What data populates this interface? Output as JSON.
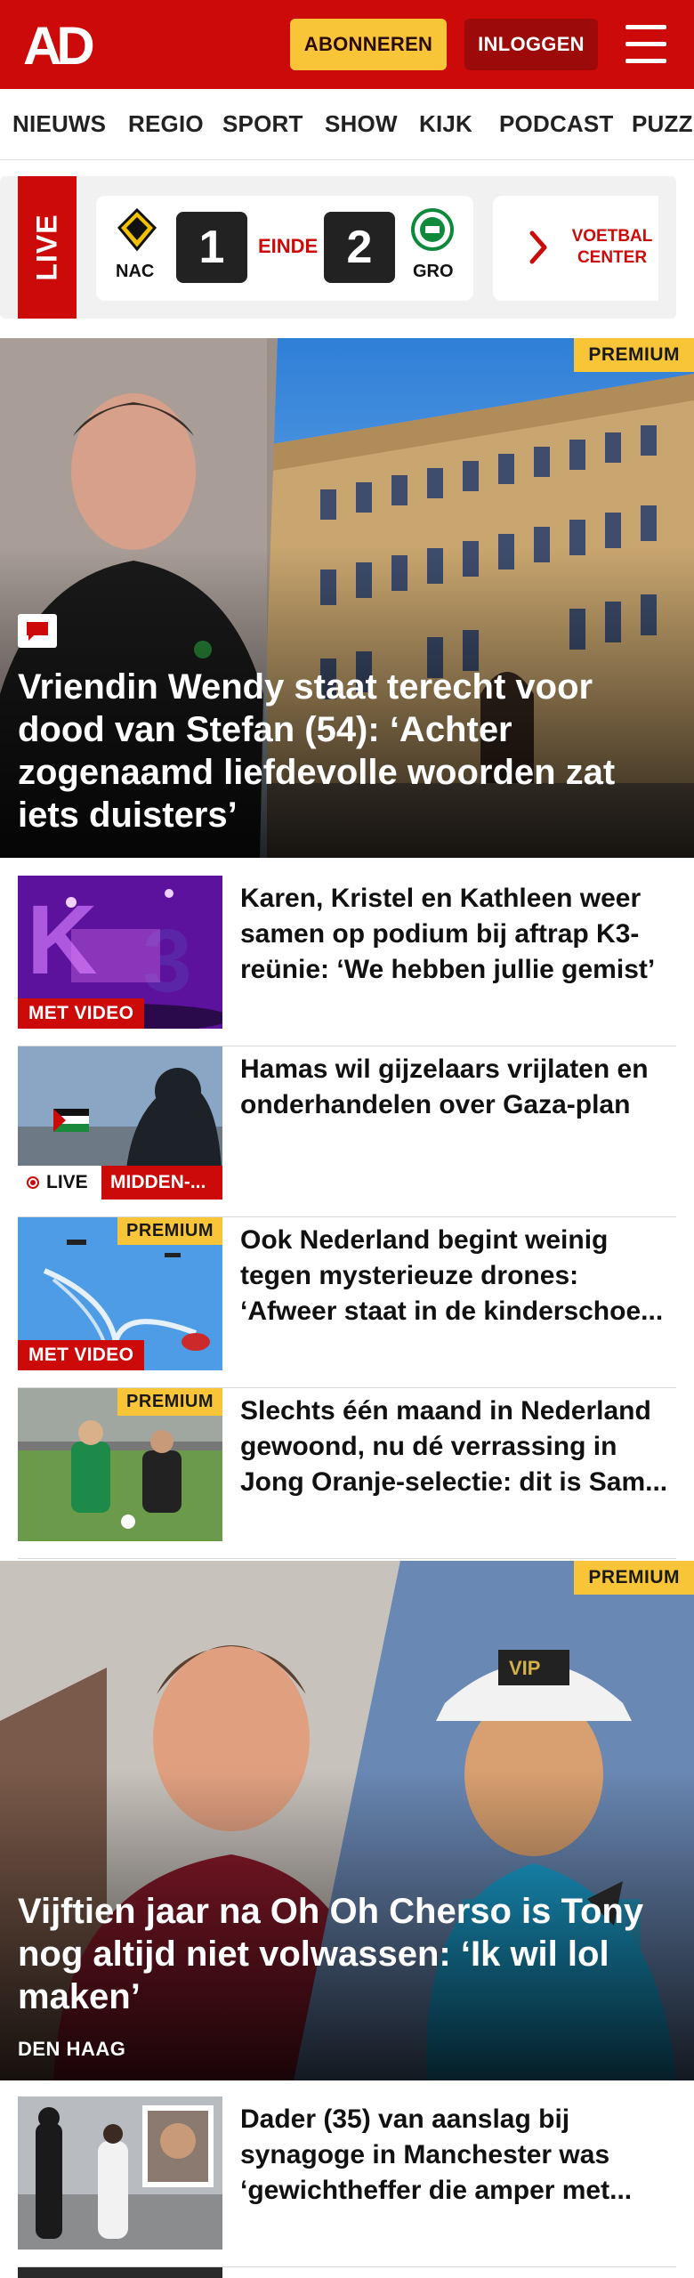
{
  "header": {
    "logo_text": "AD",
    "subscribe_label": "ABONNEREN",
    "login_label": "INLOGGEN",
    "brand_color": "#cc0a0a",
    "accent_color": "#f9c538"
  },
  "nav": {
    "items": [
      "NIEUWS",
      "REGIO",
      "SPORT",
      "SHOW",
      "KIJK",
      "PODCAST",
      "PUZZ"
    ]
  },
  "live": {
    "tag": "LIVE",
    "match": {
      "home_team": "NAC",
      "home_score": "1",
      "status": "EINDE",
      "away_score": "2",
      "away_team": "GRO"
    },
    "center_button": "VOETBAL CENTER"
  },
  "hero": {
    "badge": "PREMIUM",
    "title": "Vriendin Wendy staat terecht voor dood van Stefan (54): ‘Achter zogenaamd liefdevolle woorden zat iets duisters’",
    "icon": "comment-icon"
  },
  "articles": [
    {
      "title": "Karen, Kristel en Kathleen weer samen op podium bij aftrap K3-reünie: ‘We hebben jullie gemist’",
      "badge": "MET VIDEO"
    },
    {
      "title": "Hamas wil gijzelaars vrijlaten en onderhandelen over Gaza-plan",
      "live_label": "LIVE",
      "category": "MIDDEN-..."
    },
    {
      "title": "Ook Nederland begint weinig tegen mysterieuze drones: ‘Afweer staat in de kinderschoe...",
      "badge": "MET VIDEO",
      "premium": "PREMIUM"
    },
    {
      "title": "Slechts één maand in Nederland gewoond, nu dé verrassing in Jong Oranje-selectie: dit is Sam...",
      "premium": "PREMIUM"
    }
  ],
  "hero2": {
    "badge": "PREMIUM",
    "title": "Vijftien jaar na Oh Oh Cherso is Tony nog altijd niet volwassen: ‘Ik wil lol maken’",
    "location": "DEN HAAG"
  },
  "article_bottom": {
    "title": "Dader (35) van aanslag bij synagoge in Manchester was ‘gewichtheffer die amper met..."
  }
}
